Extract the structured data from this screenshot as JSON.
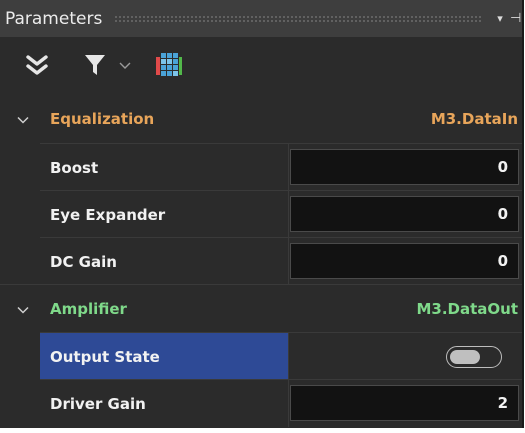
{
  "panel": {
    "title": "Parameters",
    "dropdown_glyph": "▾",
    "pin_glyph": "⊣"
  },
  "toolbar": {
    "icons": [
      "collapse-all-icon",
      "filter-icon",
      "chevron-down-icon",
      "columns-grid-icon"
    ]
  },
  "categories": [
    {
      "name": "Equalization",
      "source": "M3.DataIn",
      "color": "#e8a55a",
      "properties": [
        {
          "name": "Boost",
          "value": "0"
        },
        {
          "name": "Eye Expander",
          "value": "0"
        },
        {
          "name": "DC Gain",
          "value": "0"
        }
      ]
    },
    {
      "name": "Amplifier",
      "source": "M3.DataOut",
      "color": "#7fd98a",
      "properties": [
        {
          "name": "Output State",
          "toggle_on": false,
          "selected": true
        },
        {
          "name": "Driver Gain",
          "value": "2"
        }
      ]
    }
  ],
  "colors": {
    "panel_bg": "#2b2b2b",
    "titlebar_bg": "#3e3e3e",
    "selection": "#2e4a96",
    "input_bg": "#121212"
  }
}
